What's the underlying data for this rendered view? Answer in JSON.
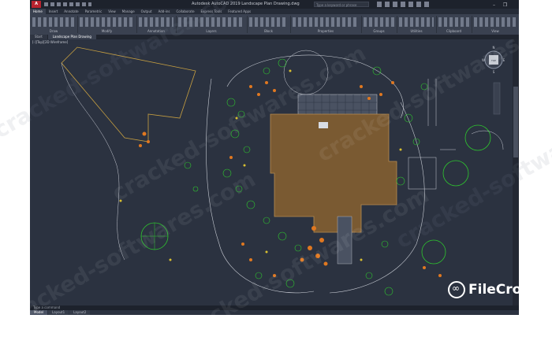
{
  "app": {
    "app_button": "A",
    "title": "Autodesk AutoCAD 2019    Landscape Plan Drawing.dwg",
    "search_placeholder": "Type a keyword or phrase",
    "window_controls": "– ❐ ✕"
  },
  "ribbon_tabs": [
    "Home",
    "Insert",
    "Annotate",
    "Parametric",
    "View",
    "Manage",
    "Output",
    "Add-ins",
    "Collaborate",
    "Express Tools",
    "Featured Apps"
  ],
  "ribbon_panels": [
    "Draw",
    "Modify",
    "Annotation",
    "Layers",
    "Block",
    "Properties",
    "Groups",
    "Utilities",
    "Clipboard",
    "View"
  ],
  "file_tabs": [
    "Start",
    "Landscape Plan Drawing"
  ],
  "viewport": {
    "label": "[-][Top][2D Wireframe]",
    "compass": {
      "n": "N",
      "e": "E",
      "s": "S",
      "w": "W",
      "center": "TOP"
    }
  },
  "command_line": "Type a command",
  "layout_tabs": [
    "Model",
    "Layout1",
    "Layout2"
  ],
  "watermark_text": "cracked-softwares.com",
  "logo_text": "FileCr",
  "logo_suffix": "op",
  "colors": {
    "background": "#2b3240",
    "building": "#7a5a32",
    "plants_green": "#2ec82e",
    "plants_orange": "#e07820",
    "plants_yellow": "#d8c030",
    "linework": "#c8ccd4",
    "brand_red": "#b8232f"
  }
}
